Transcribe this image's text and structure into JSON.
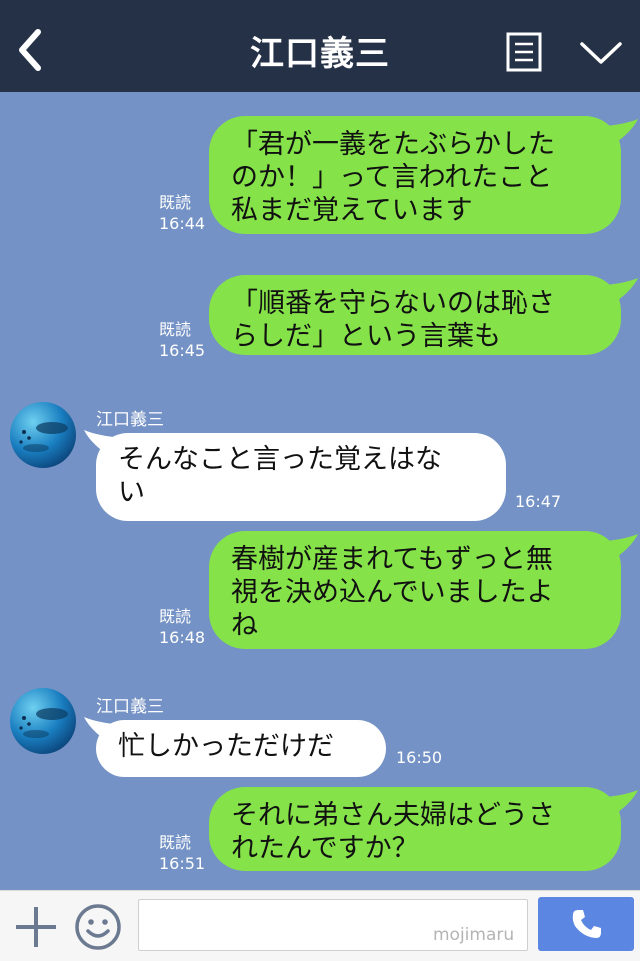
{
  "header": {
    "title": "江口義三",
    "icons": {
      "back": "chevron-left-icon",
      "menu": "list-icon",
      "collapse": "chevron-down-icon"
    }
  },
  "messages": [
    {
      "dir": "out",
      "text": "「君が一義をたぶらかした\nのか！」って言われたこと\n私まだ覚えています",
      "read": "既読",
      "time": "16:44"
    },
    {
      "dir": "out",
      "text": "「順番を守らないのは恥さ\nらしだ」という言葉も",
      "read": "既読",
      "time": "16:45"
    },
    {
      "dir": "in",
      "sender": "江口義三",
      "text": "そんなこと言った覚えはな\nい",
      "time": "16:47"
    },
    {
      "dir": "out",
      "text": "春樹が産まれてもずっと無\n視を決め込んでいましたよ\nね",
      "read": "既読",
      "time": "16:48"
    },
    {
      "dir": "in",
      "sender": "江口義三",
      "text": "忙しかっただけだ",
      "time": "16:50"
    },
    {
      "dir": "out",
      "text": "それに弟さん夫婦はどうさ\nれたんですか？",
      "read": "既読",
      "time": "16:51"
    }
  ],
  "footer": {
    "input_value": "",
    "watermark": "mojimaru",
    "icons": {
      "plus": "plus-icon",
      "emoji": "smiley-icon",
      "call": "phone-icon"
    }
  },
  "colors": {
    "header_bg": "#253147",
    "chat_bg": "#7492c5",
    "outgoing_bubble": "#85e249",
    "incoming_bubble": "#ffffff",
    "call_button": "#5b87e2"
  }
}
